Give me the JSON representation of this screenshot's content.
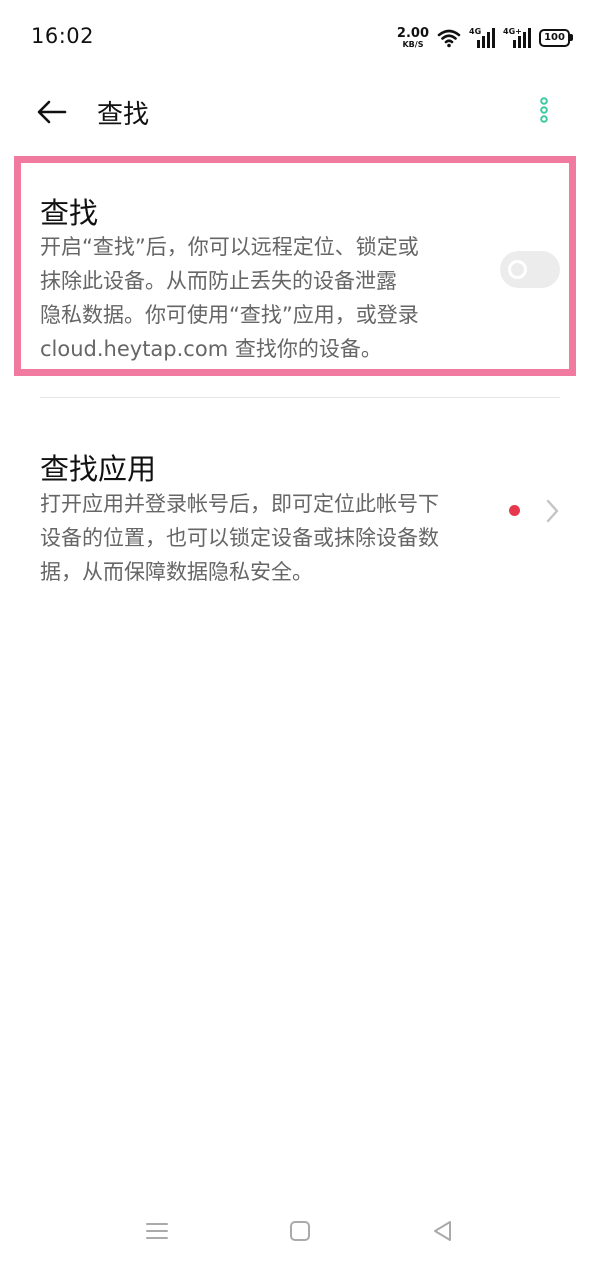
{
  "status_bar": {
    "time": "16:02",
    "net_speed_value": "2.00",
    "net_speed_unit": "KB/S",
    "signal1_label": "4G",
    "signal2_label": "4G+",
    "battery": "100"
  },
  "header": {
    "title": "查找",
    "back_icon": "arrow-left-icon",
    "more_icon": "more-vertical-icon",
    "accent_color": "#3dc9a0"
  },
  "find_device": {
    "title": "查找",
    "desc_lines": [
      "开启“查找”后，你可以远程定位、锁定或",
      "抹除此设备。从而防止丢失的设备泄露",
      "隐私数据。你可使用“查找”应用，或登录",
      "cloud.heytap.com  查找你的设备。"
    ],
    "toggle_on": false
  },
  "find_app": {
    "title": "查找应用",
    "desc_lines": [
      "打开应用并登录帐号后，即可定位此帐号下",
      "设备的位置，也可以锁定设备或抹除设备数",
      "据，从而保障数据隐私安全。"
    ],
    "badge_color": "#e5384c"
  },
  "highlight_color": "#f17aa0",
  "nav_bar": {
    "menu_icon": "menu-icon",
    "home_icon": "square-home-icon",
    "back_icon": "triangle-back-icon"
  }
}
